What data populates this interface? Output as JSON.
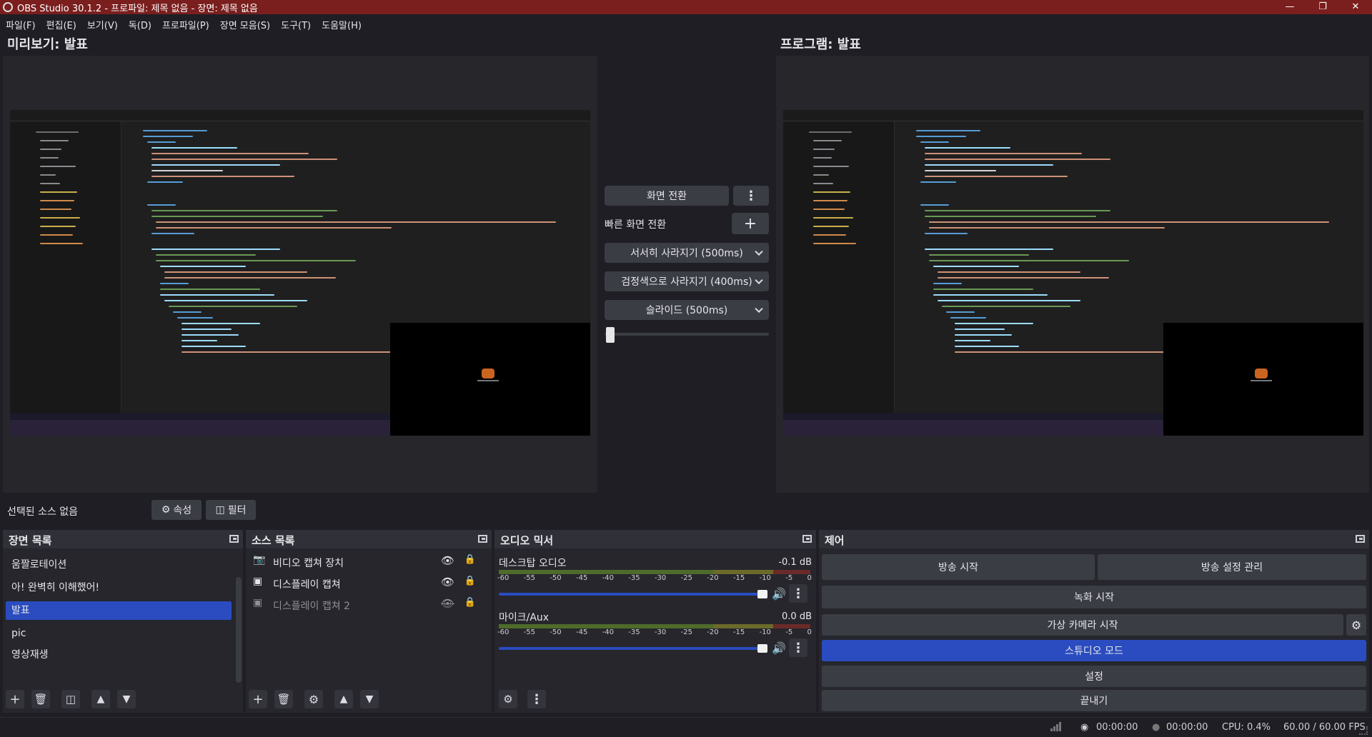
{
  "title_bar": {
    "title": "OBS Studio 30.1.2 - 프로파일: 제목 없음 - 장면: 제목 없음",
    "minimize": "—",
    "maximize": "❐",
    "close": "✕"
  },
  "menu": [
    "파일(F)",
    "편집(E)",
    "보기(V)",
    "독(D)",
    "프로파일(P)",
    "장면 모음(S)",
    "도구(T)",
    "도움말(H)"
  ],
  "preview": {
    "label": "미리보기: 발표"
  },
  "program": {
    "label": "프로그램: 발표"
  },
  "transition": {
    "scene_transition_button": "화면 전환",
    "quick_transitions_label": "빠른 화면 전환",
    "quick": [
      "서서히 사라지기 (500ms)",
      "검정색으로 사라지기 (400ms)",
      "슬라이드 (500ms)"
    ]
  },
  "source_toolbar": {
    "no_source": "선택된 소스 없음",
    "properties": "속성",
    "filters": "필터"
  },
  "scenes": {
    "title": "장면 목록",
    "items": [
      "움짤로테이션",
      "아! 완벽히 이해했어!",
      "발표",
      "pic",
      "영상재생"
    ],
    "selected_index": 2
  },
  "sources": {
    "title": "소스 목록",
    "items": [
      {
        "name": "비디오 캡쳐 장치",
        "visible": true,
        "locked": true
      },
      {
        "name": "디스플레이 캡쳐",
        "visible": true,
        "locked": true
      },
      {
        "name": "디스플레이 캡쳐 2",
        "visible": false,
        "locked": true
      }
    ]
  },
  "audio_mixer": {
    "title": "오디오 믹서",
    "channels": [
      {
        "name": "데스크탑 오디오",
        "db": "-0.1 dB",
        "volume": 0.98
      },
      {
        "name": "마이크/Aux",
        "db": "0.0 dB",
        "volume": 1.0
      }
    ],
    "ticks": [
      "-60",
      "-55",
      "-50",
      "-45",
      "-40",
      "-35",
      "-30",
      "-25",
      "-20",
      "-15",
      "-10",
      "-5",
      "0"
    ]
  },
  "controls": {
    "title": "제어",
    "start_streaming": "방송 시작",
    "manage_broadcast": "방송 설정 관리",
    "start_recording": "녹화 시작",
    "start_virtual_camera": "가상 카메라 시작",
    "studio_mode": "스튜디오 모드",
    "settings": "설정",
    "exit": "끝내기"
  },
  "status_bar": {
    "stream_time": "00:00:00",
    "record_time": "00:00:00",
    "cpu": "CPU: 0.4%",
    "fps": "60.00 / 60.00 FPS"
  },
  "colors": {
    "accent": "#2a4cc0",
    "titlebar": "#7a1e1e",
    "panel": "#26262c",
    "button": "#3b3d45"
  }
}
